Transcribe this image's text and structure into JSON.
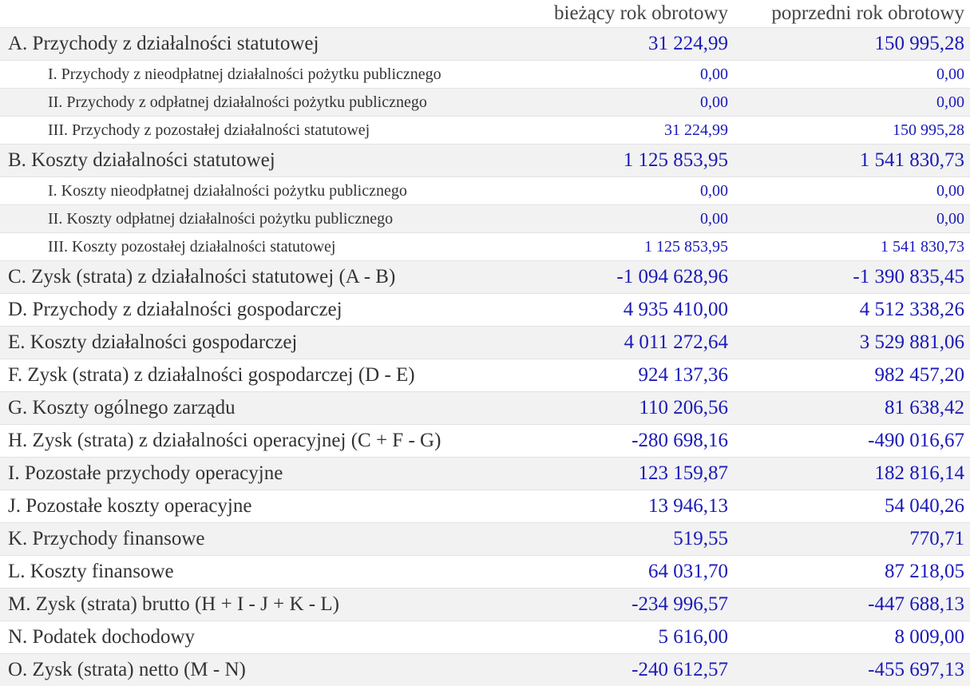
{
  "header": {
    "current_year": "bieżący rok obrotowy",
    "previous_year": "poprzedni rok obrotowy"
  },
  "rows": [
    {
      "label": "A. Przychody z działalności statutowej",
      "current": "31 224,99",
      "previous": "150 995,28"
    },
    {
      "label": "I. Przychody z nieodpłatnej działalności pożytku publicznego",
      "current": "0,00",
      "previous": "0,00"
    },
    {
      "label": "II. Przychody z odpłatnej działalności pożytku publicznego",
      "current": "0,00",
      "previous": "0,00"
    },
    {
      "label": "III. Przychody z pozostałej działalności statutowej",
      "current": "31 224,99",
      "previous": "150 995,28"
    },
    {
      "label": "B. Koszty działalności statutowej",
      "current": "1 125 853,95",
      "previous": "1 541 830,73"
    },
    {
      "label": "I. Koszty nieodpłatnej działalności pożytku publicznego",
      "current": "0,00",
      "previous": "0,00"
    },
    {
      "label": "II. Koszty odpłatnej działalności pożytku publicznego",
      "current": "0,00",
      "previous": "0,00"
    },
    {
      "label": "III. Koszty pozostałej działalności statutowej",
      "current": "1 125 853,95",
      "previous": "1 541 830,73"
    },
    {
      "label": "C. Zysk (strata) z działalności statutowej (A - B)",
      "current": "-1 094 628,96",
      "previous": "-1 390 835,45"
    },
    {
      "label": "D. Przychody z działalności gospodarczej",
      "current": "4 935 410,00",
      "previous": "4 512 338,26"
    },
    {
      "label": "E. Koszty działalności gospodarczej",
      "current": "4 011 272,64",
      "previous": "3 529 881,06"
    },
    {
      "label": "F. Zysk (strata) z działalności gospodarczej (D - E)",
      "current": "924 137,36",
      "previous": "982 457,20"
    },
    {
      "label": "G. Koszty ogólnego zarządu",
      "current": "110 206,56",
      "previous": "81 638,42"
    },
    {
      "label": "H. Zysk (strata) z działalności operacyjnej (C + F - G)",
      "current": "-280 698,16",
      "previous": "-490 016,67"
    },
    {
      "label": "I. Pozostałe przychody operacyjne",
      "current": "123 159,87",
      "previous": "182 816,14"
    },
    {
      "label": "J. Pozostałe koszty operacyjne",
      "current": "13 946,13",
      "previous": "54 040,26"
    },
    {
      "label": "K. Przychody finansowe",
      "current": "519,55",
      "previous": "770,71"
    },
    {
      "label": "L. Koszty finansowe",
      "current": "64 031,70",
      "previous": "87 218,05"
    },
    {
      "label": "M. Zysk (strata) brutto (H + I - J + K - L)",
      "current": "-234 996,57",
      "previous": "-447 688,13"
    },
    {
      "label": "N. Podatek dochodowy",
      "current": "5 616,00",
      "previous": "8 009,00"
    },
    {
      "label": "O. Zysk (strata) netto (M - N)",
      "current": "-240 612,57",
      "previous": "-455 697,13"
    }
  ]
}
